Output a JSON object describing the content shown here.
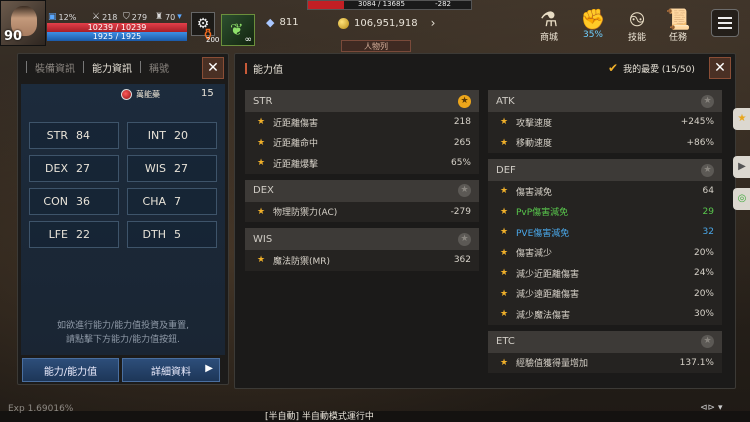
{
  "hud": {
    "level": "90",
    "stat_a": "12%",
    "stat_b": "218",
    "stat_c": "279",
    "stat_d": "70",
    "hp": "10239 / 10239",
    "mp": "1925 / 1925",
    "potion_count": "200",
    "slot_count": "∞",
    "gem": "811",
    "gold": "106,951,918",
    "exp_top_left": "3084 / 13685",
    "exp_top_right": "-282",
    "mini_tab": "人物列",
    "icon1": "商城",
    "icon2": "35%",
    "icon3": "技能",
    "icon4": "任務"
  },
  "left_panel": {
    "tabs": [
      "裝備資訊",
      "能力資訊",
      "稱號"
    ],
    "elixir_label": "萬能藥",
    "elixir_count": "15",
    "stats": [
      {
        "k": "STR",
        "v": "84"
      },
      {
        "k": "INT",
        "v": "20"
      },
      {
        "k": "DEX",
        "v": "27"
      },
      {
        "k": "WIS",
        "v": "27"
      },
      {
        "k": "CON",
        "v": "36"
      },
      {
        "k": "CHA",
        "v": "7"
      },
      {
        "k": "LFE",
        "v": "22"
      },
      {
        "k": "DTH",
        "v": "5"
      }
    ],
    "hint_line1": "如欲進行能力/能力值投資及重置,",
    "hint_line2": "請點擊下方能力/能力值按鈕.",
    "btn_ability": "能力/能力值",
    "btn_detail": "詳細資料"
  },
  "right_panel": {
    "title": "能力值",
    "favorites": "我的最愛 (15/50)",
    "left_groups": [
      {
        "name": "STR",
        "fav": true,
        "rows": [
          {
            "n": "近距離傷害",
            "v": "218"
          },
          {
            "n": "近距離命中",
            "v": "265"
          },
          {
            "n": "近距離爆擊",
            "v": "65%"
          }
        ]
      },
      {
        "name": "DEX",
        "fav": false,
        "rows": [
          {
            "n": "物理防禦力(AC)",
            "v": "-279"
          }
        ]
      },
      {
        "name": "WIS",
        "fav": false,
        "rows": [
          {
            "n": "魔法防禦(MR)",
            "v": "362"
          }
        ]
      }
    ],
    "right_groups": [
      {
        "name": "ATK",
        "fav": false,
        "rows": [
          {
            "n": "攻擊速度",
            "v": "+245%"
          },
          {
            "n": "移動速度",
            "v": "+86%"
          }
        ]
      },
      {
        "name": "DEF",
        "fav": false,
        "rows": [
          {
            "n": "傷害減免",
            "v": "64"
          },
          {
            "n": "PvP傷害減免",
            "v": "29",
            "c": "green"
          },
          {
            "n": "PVE傷害減免",
            "v": "32",
            "c": "blue"
          },
          {
            "n": "傷害減少",
            "v": "20%"
          },
          {
            "n": "減少近距離傷害",
            "v": "24%"
          },
          {
            "n": "減少遠距離傷害",
            "v": "20%"
          },
          {
            "n": "減少魔法傷害",
            "v": "30%"
          }
        ]
      },
      {
        "name": "ETC",
        "fav": false,
        "rows": [
          {
            "n": "經驗值獲得量增加",
            "v": "137.1%"
          }
        ]
      }
    ]
  },
  "footer": {
    "exp": "Exp 1.69016%",
    "auto_mode": "[半自動] 半自動模式運行中"
  },
  "colors": {
    "accent": "#c85a38",
    "star": "#f0b02a",
    "green": "#59c84d",
    "blue": "#4aa8ea"
  }
}
